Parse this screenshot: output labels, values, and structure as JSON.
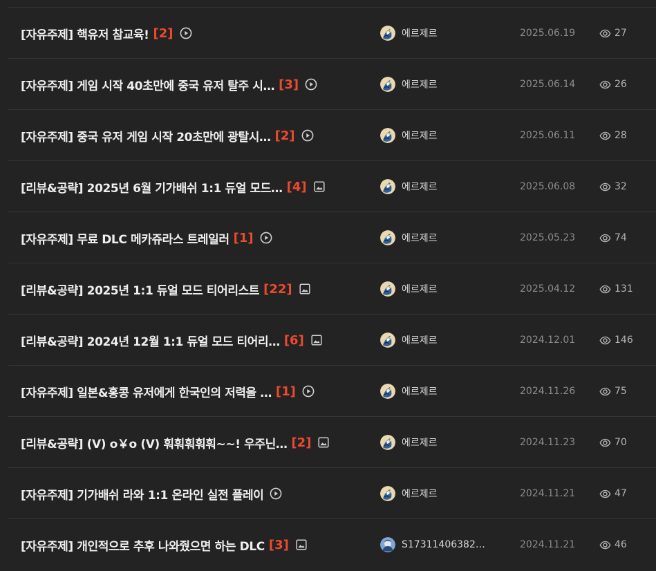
{
  "posts": [
    {
      "title": "[자유주제] 핵유저 참교육!",
      "count": "[2]",
      "type_icon": "play-circle-icon",
      "author": "에르제르",
      "avatar": "author-avatar-1",
      "date": "2025.06.19",
      "views": "27"
    },
    {
      "title": "[자유주제] 게임 시작 40초만에 중국 유저 탈주 시…",
      "count": "[3]",
      "type_icon": "play-circle-icon",
      "author": "에르제르",
      "avatar": "author-avatar-1",
      "date": "2025.06.14",
      "views": "26"
    },
    {
      "title": "[자유주제] 중국 유저 게임 시작 20초만에 광탈시…",
      "count": "[2]",
      "type_icon": "play-circle-icon",
      "author": "에르제르",
      "avatar": "author-avatar-1",
      "date": "2025.06.11",
      "views": "28"
    },
    {
      "title": "[리뷰&공략] 2025년 6월 기가배쉬 1:1 듀얼 모드…",
      "count": "[4]",
      "type_icon": "image-icon",
      "author": "에르제르",
      "avatar": "author-avatar-1",
      "date": "2025.06.08",
      "views": "32"
    },
    {
      "title": "[자유주제] 무료 DLC 메카쥬라스 트레일러",
      "count": "[1]",
      "type_icon": "play-circle-icon",
      "author": "에르제르",
      "avatar": "author-avatar-1",
      "date": "2025.05.23",
      "views": "74"
    },
    {
      "title": "[리뷰&공략] 2025년 1:1 듀얼 모드 티어리스트",
      "count": "[22]",
      "type_icon": "image-icon",
      "author": "에르제르",
      "avatar": "author-avatar-1",
      "date": "2025.04.12",
      "views": "131"
    },
    {
      "title": "[리뷰&공략] 2024년 12월 1:1 듀얼 모드 티어리…",
      "count": "[6]",
      "type_icon": "image-icon",
      "author": "에르제르",
      "avatar": "author-avatar-1",
      "date": "2024.12.01",
      "views": "146"
    },
    {
      "title": "[자유주제] 일본&홍콩 유저에게 한국인의 저력을 …",
      "count": "[1]",
      "type_icon": "play-circle-icon",
      "author": "에르제르",
      "avatar": "author-avatar-1",
      "date": "2024.11.26",
      "views": "75"
    },
    {
      "title": "[리뷰&공략] (V) o￥o (V) 훠훠훠훠훠~~! 우주닌…",
      "count": "[2]",
      "type_icon": "image-icon",
      "author": "에르제르",
      "avatar": "author-avatar-1",
      "date": "2024.11.23",
      "views": "70"
    },
    {
      "title": "[자유주제] 기가배쉬 라와 1:1 온라인 실전 플레이",
      "count": "",
      "type_icon": "play-circle-icon",
      "author": "에르제르",
      "avatar": "author-avatar-1",
      "date": "2024.11.21",
      "views": "47"
    },
    {
      "title": "[자유주제] 개인적으로 추후 나와줬으면 하는 DLC",
      "count": "[3]",
      "type_icon": "image-icon",
      "author": "S17311406382…",
      "avatar": "author-avatar-2",
      "date": "2024.11.21",
      "views": "46"
    }
  ],
  "colors": {
    "background": "#232323",
    "divider": "#353535",
    "title": "#efefef",
    "comment_count": "#ee4a2e",
    "date": "#8c8c8c",
    "views": "#b4b4b4"
  }
}
